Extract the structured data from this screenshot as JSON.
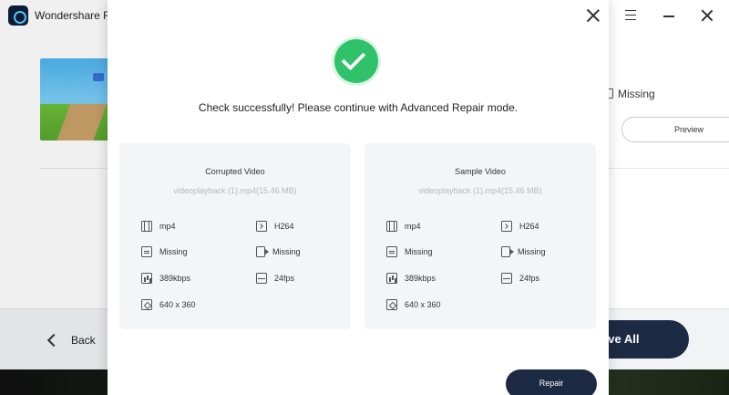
{
  "app": {
    "title": "Wondershare Repa",
    "bg_status": "Missing",
    "bg_preview": "Preview",
    "back_label": "Back",
    "save_all_label": "ave All"
  },
  "modal": {
    "message": "Check successfully! Please continue with Advanced Repair mode.",
    "repair_label": "Repair",
    "panels": [
      {
        "title": "Corrupted Video",
        "file": "videoplayback (1).mp4(15.46  MB)",
        "format": "mp4",
        "codec": "H264",
        "audio": "Missing",
        "video_track": "Missing",
        "bitrate": "389kbps",
        "fps": "24fps",
        "resolution": "640 x 360"
      },
      {
        "title": "Sample Video",
        "file": "videoplayback (1).mp4(15.46  MB)",
        "format": "mp4",
        "codec": "H264",
        "audio": "Missing",
        "video_track": "Missing",
        "bitrate": "389kbps",
        "fps": "24fps",
        "resolution": "640 x 360"
      }
    ]
  },
  "colors": {
    "accent_dark": "#1d2a44",
    "success_green": "#2fc26b"
  }
}
